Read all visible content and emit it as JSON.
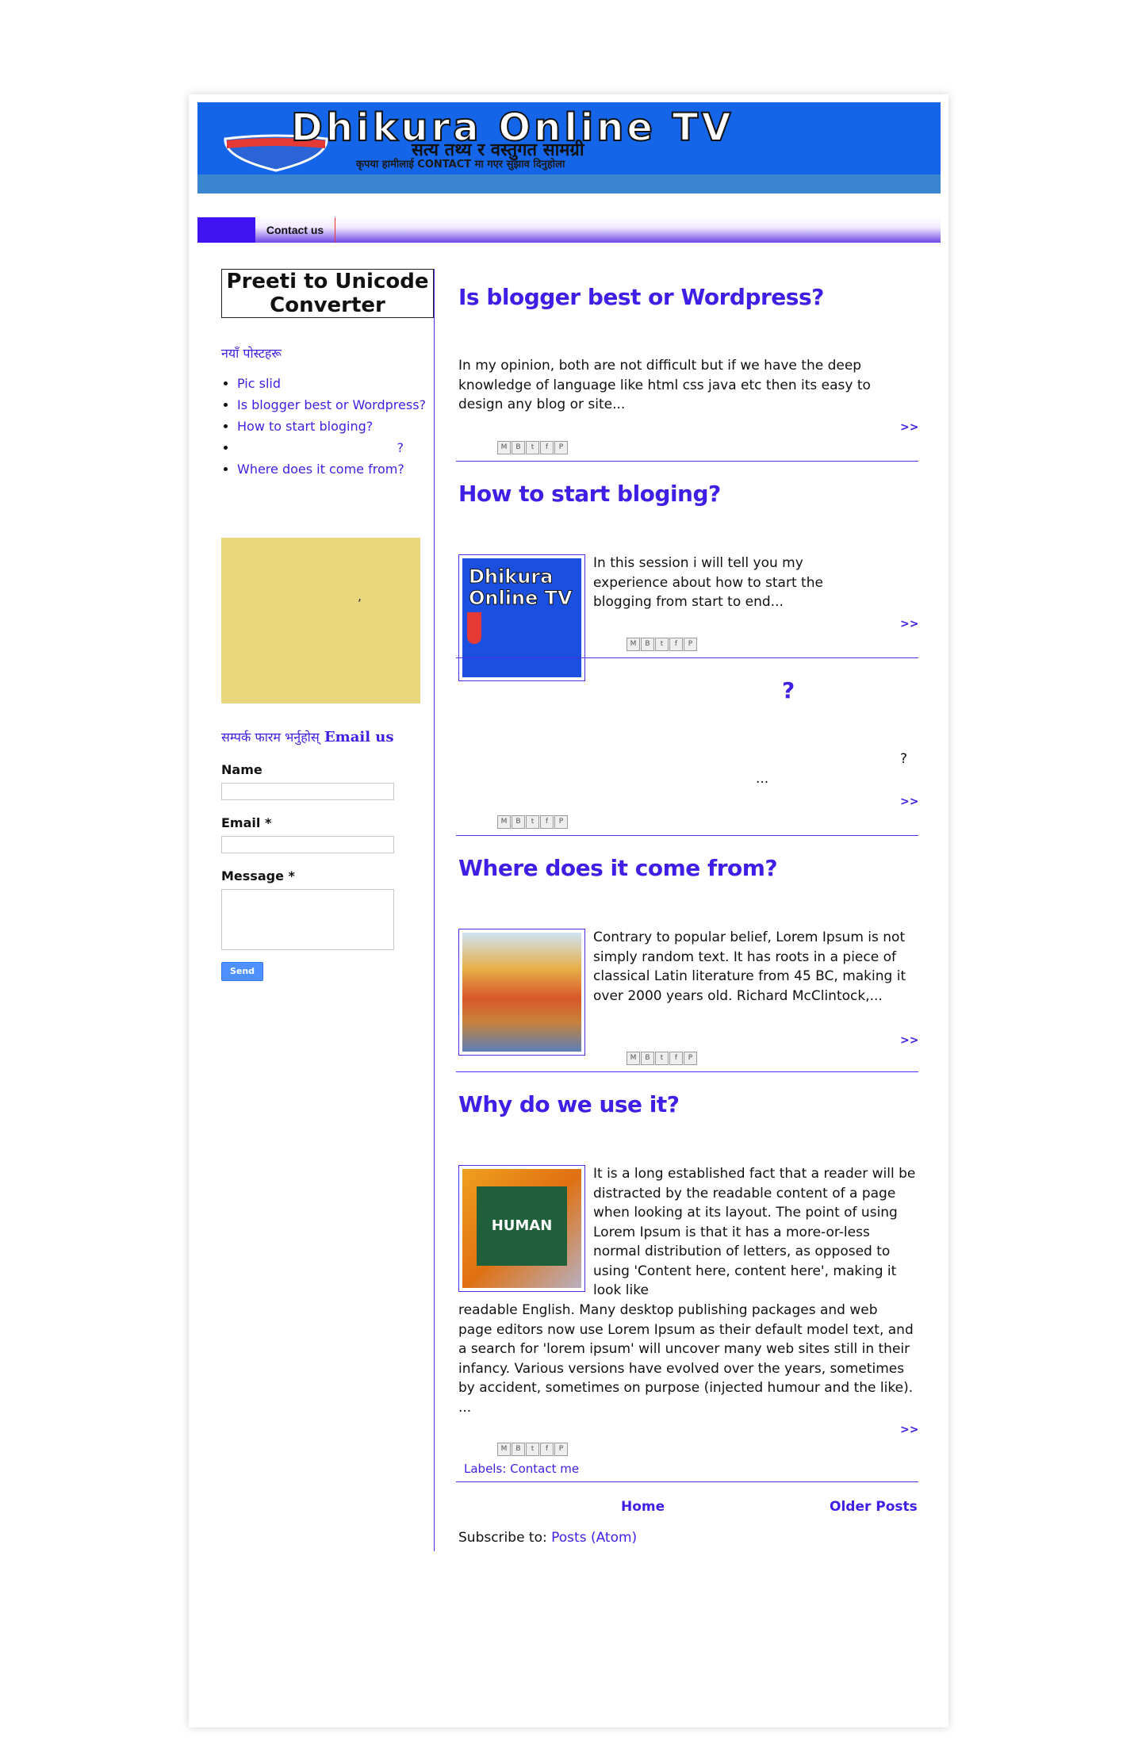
{
  "header": {
    "site_title": "Dhikura Online TV",
    "tagline": "सत्य तथ्य र वस्तुगत सामग्री",
    "notice": "कृपया हामीलाई CONTACT मा गएर सुझाव दिनुहोला"
  },
  "nav": {
    "items": [
      {
        "label": "Contact us"
      }
    ]
  },
  "sidebar": {
    "converter_label": [
      "Preeti to Unicode",
      "Converter"
    ],
    "recent_heading": "नयाँ पोस्टहरू",
    "recent_posts": [
      {
        "label": "Pic slid"
      },
      {
        "label": "Is blogger best or Wordpress?"
      },
      {
        "label": "How to start bloging?"
      },
      {
        "label": "?"
      },
      {
        "label": "Where does it come from?"
      }
    ],
    "widget_char": ",",
    "contact": {
      "title_prefix": "सम्पर्क फारम भर्नुहोस्",
      "title_suffix": "Email us",
      "name_label": "Name",
      "email_label": "Email *",
      "message_label": "Message *",
      "send_label": "Send"
    }
  },
  "posts": [
    {
      "title": "Is blogger best or Wordpress?",
      "snippet": "In my opinion, both are not difficult  but if we have the deep knowledge of language  like html css java etc then its easy to design any blog or site...",
      "more": ">>"
    },
    {
      "title": "How to start bloging?",
      "snippet": "In this session i will tell you my experience about how to start the blogging from start to end...",
      "more": ">>",
      "thumb_title": "Dhikura Online TV"
    },
    {
      "title": "?",
      "snippet_line1": "?",
      "snippet_line2": "...",
      "more": ">>"
    },
    {
      "title": "Where does it come from?",
      "snippet": "Contrary to popular belief, Lorem Ipsum is not simply random text. It has roots in a piece of classical Latin literature from 45 BC, making it over 2000 years old. Richard McClintock,...",
      "more": ">>"
    },
    {
      "title": "Why do we use it?",
      "snippet_top": "It is a long established fact that a reader will be distracted by the readable content of a page when looking at its layout. The point of using Lorem Ipsum is that it has a more-or-less normal distribution of letters, as opposed to using 'Content here, content here', making it look like",
      "snippet_bottom": "readable English. Many desktop publishing packages and web page editors now use Lorem Ipsum as their default model text, and a search for 'lorem ipsum' will uncover many web sites still in their infancy. Various versions have evolved over the years, sometimes by accident, sometimes on purpose (injected humour and the like). ...",
      "more": ">>",
      "labels_prefix": "Labels:",
      "labels_value": "Contact me",
      "thumb_word": "HUMAN"
    }
  ],
  "share_buttons": [
    "M",
    "B",
    "t",
    "f",
    "P"
  ],
  "footer": {
    "home": "Home",
    "older": "Older Posts",
    "subscribe_prefix": "Subscribe to:",
    "subscribe_link": "Posts (Atom)"
  }
}
